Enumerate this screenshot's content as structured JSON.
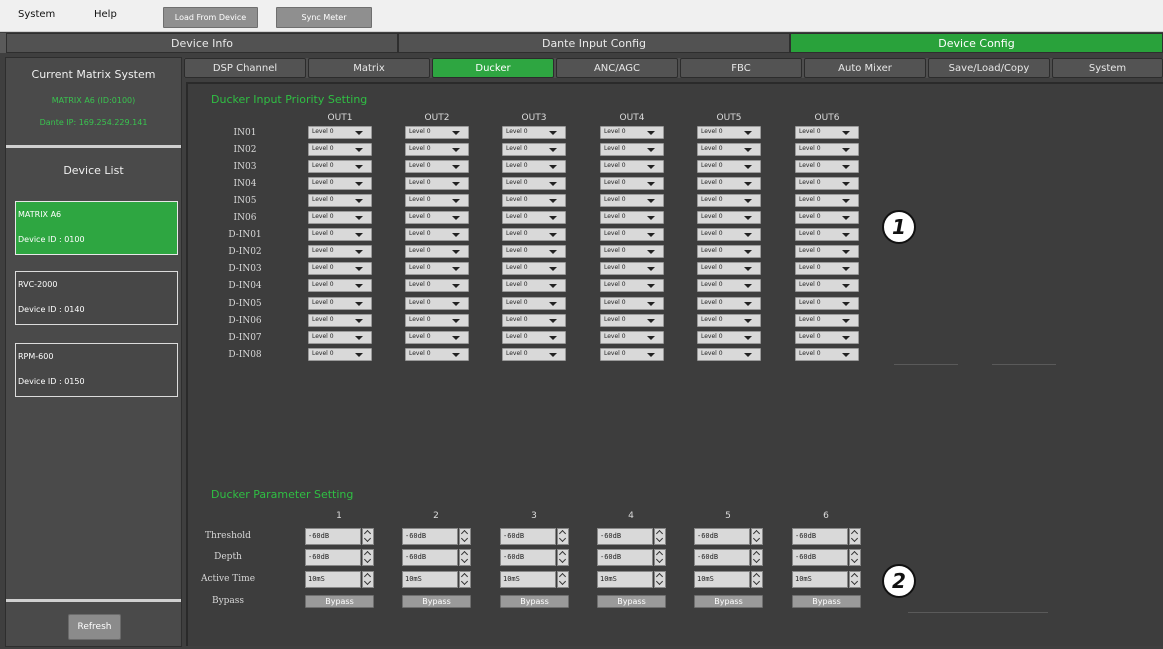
{
  "menu": {
    "system": "System",
    "help": "Help",
    "load_from_device": "Load From Device",
    "sync_meter": "Sync Meter"
  },
  "main_tabs": [
    "Device Info",
    "Dante Input Config",
    "Device Config"
  ],
  "left": {
    "current_title": "Current Matrix System",
    "matrix_name": "MATRIX A6 (ID:0100)",
    "dante_ip": "Dante IP: 169.254.229.141",
    "device_list_title": "Device List",
    "devices": [
      {
        "name": "MATRIX A6",
        "id": "Device ID : 0100"
      },
      {
        "name": "RVC-2000",
        "id": "Device ID : 0140"
      },
      {
        "name": "RPM-600",
        "id": "Device ID : 0150"
      }
    ],
    "refresh": "Refresh"
  },
  "sub_tabs": [
    "DSP Channel",
    "Matrix",
    "Ducker",
    "ANC/AGC",
    "FBC",
    "Auto Mixer",
    "Save/Load/Copy",
    "System"
  ],
  "ducker": {
    "priority_title": "Ducker Input Priority Setting",
    "outputs": [
      "OUT1",
      "OUT2",
      "OUT3",
      "OUT4",
      "OUT5",
      "OUT6"
    ],
    "inputs": [
      "IN01",
      "IN02",
      "IN03",
      "IN04",
      "IN05",
      "IN06",
      "D-IN01",
      "D-IN02",
      "D-IN03",
      "D-IN04",
      "D-IN05",
      "D-IN06",
      "D-IN07",
      "D-IN08"
    ],
    "level_value": "Level 0",
    "param_title": "Ducker Parameter Setting",
    "param_columns": [
      "1",
      "2",
      "3",
      "4",
      "5",
      "6"
    ],
    "threshold_label": "Threshold",
    "depth_label": "Depth",
    "active_time_label": "Active Time",
    "bypass_label": "Bypass",
    "threshold_value": "-60dB",
    "depth_value": "-60dB",
    "active_time_value": "10mS",
    "bypass_button": "Bypass"
  },
  "callouts": [
    "1",
    "2"
  ]
}
